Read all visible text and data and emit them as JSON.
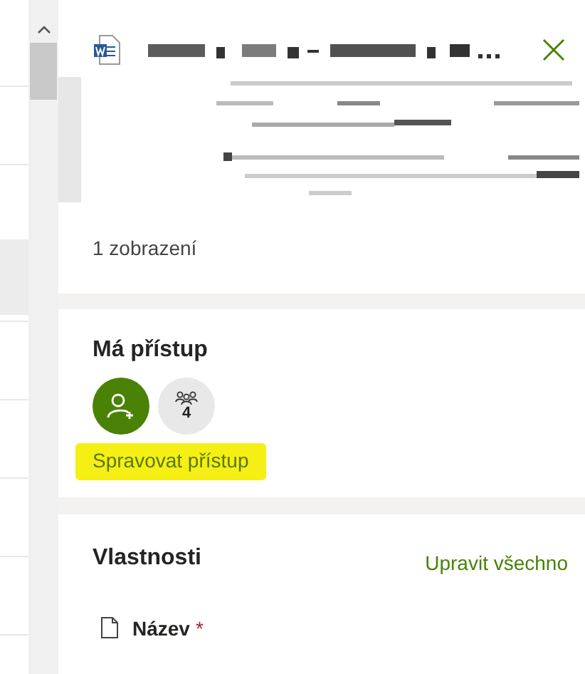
{
  "panel": {
    "views": "1 zobrazení"
  },
  "access": {
    "heading": "Má přístup",
    "members": [
      {
        "kind": "add-person"
      },
      {
        "kind": "group",
        "count": "4"
      }
    ],
    "manage_link": {
      "label": "Spravovat přístup",
      "highlighted": true
    }
  },
  "properties": {
    "heading": "Vlastnosti",
    "edit_all": "Upravit všechno",
    "fields": [
      {
        "label": "Název",
        "required_mark": "*"
      }
    ]
  }
}
